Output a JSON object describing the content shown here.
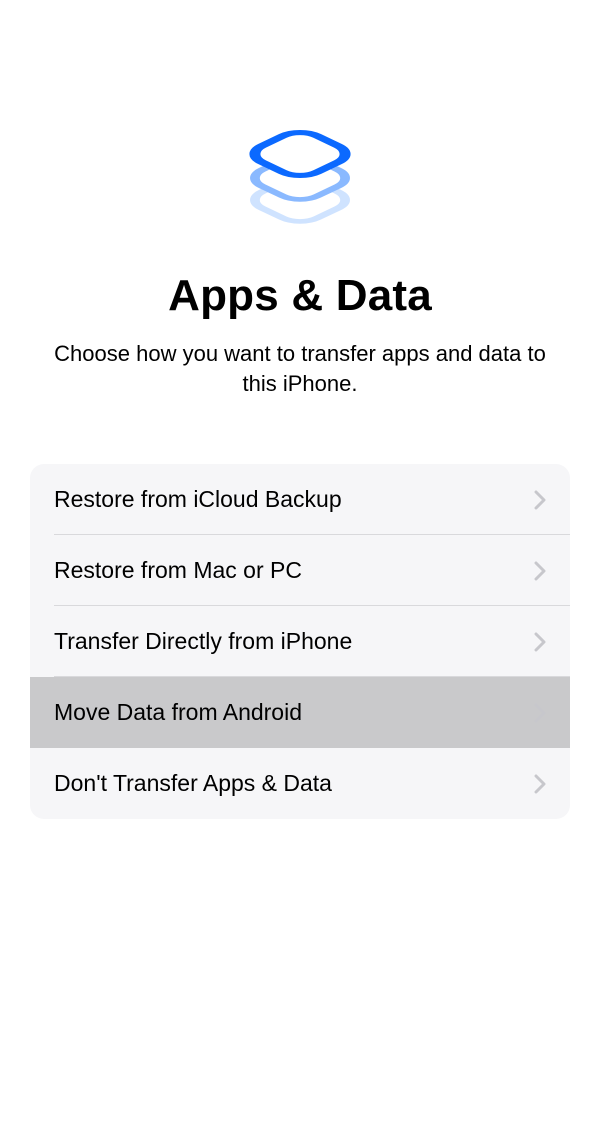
{
  "header": {
    "title": "Apps & Data",
    "subtitle": "Choose how you want to transfer apps and data to this iPhone."
  },
  "options": [
    {
      "label": "Restore from iCloud Backup",
      "name": "option-restore-icloud",
      "selected": false
    },
    {
      "label": "Restore from Mac or PC",
      "name": "option-restore-mac-pc",
      "selected": false
    },
    {
      "label": "Transfer Directly from iPhone",
      "name": "option-transfer-iphone",
      "selected": false
    },
    {
      "label": "Move Data from Android",
      "name": "option-move-android",
      "selected": true
    },
    {
      "label": "Don't Transfer Apps & Data",
      "name": "option-dont-transfer",
      "selected": false
    }
  ],
  "colors": {
    "accent": "#0b69ff",
    "chevron": "#c7c7cc"
  }
}
